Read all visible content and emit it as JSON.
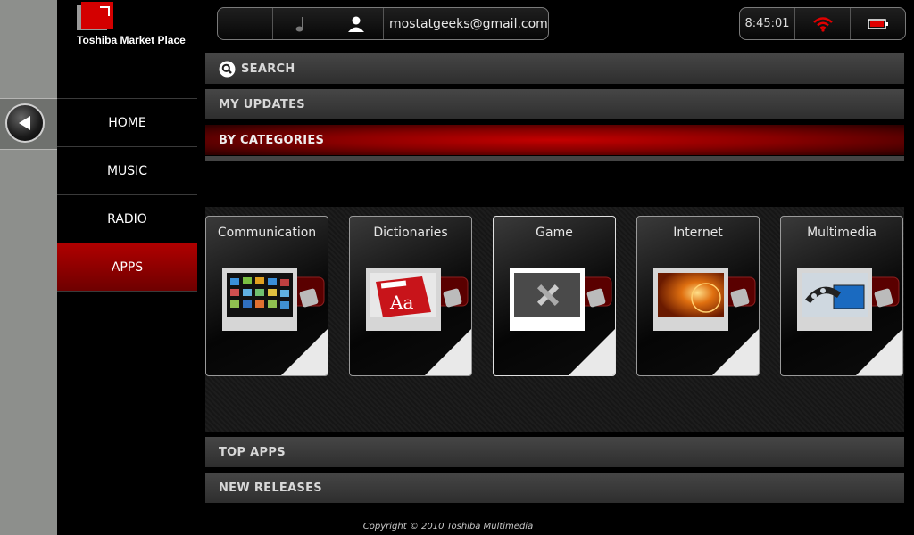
{
  "brand": {
    "name": "Toshiba Market Place"
  },
  "account": {
    "email": "mostatgeeks@gmail.com"
  },
  "status": {
    "time": "8:45:01"
  },
  "nav": {
    "items": [
      {
        "label": "HOME"
      },
      {
        "label": "MUSIC"
      },
      {
        "label": "RADIO"
      },
      {
        "label": "APPS"
      }
    ],
    "active": "APPS"
  },
  "sections": {
    "search": "SEARCH",
    "my_updates": "MY UPDATES",
    "by_categories": "BY CATEGORIES",
    "top_apps": "TOP APPS",
    "new_releases": "NEW RELEASES"
  },
  "categories": [
    {
      "label": "Communication",
      "icon": "screens-grid-icon"
    },
    {
      "label": "Dictionaries",
      "icon": "dictionary-book-icon"
    },
    {
      "label": "Game",
      "icon": "pencil-ruler-icon"
    },
    {
      "label": "Internet",
      "icon": "globe-icon"
    },
    {
      "label": "Multimedia",
      "icon": "film-reel-icon"
    }
  ],
  "footer": {
    "copyright": "Copyright © 2010 Toshiba Multimedia"
  },
  "colors": {
    "accent": "#b00000",
    "rail": "#8d8f8c"
  }
}
